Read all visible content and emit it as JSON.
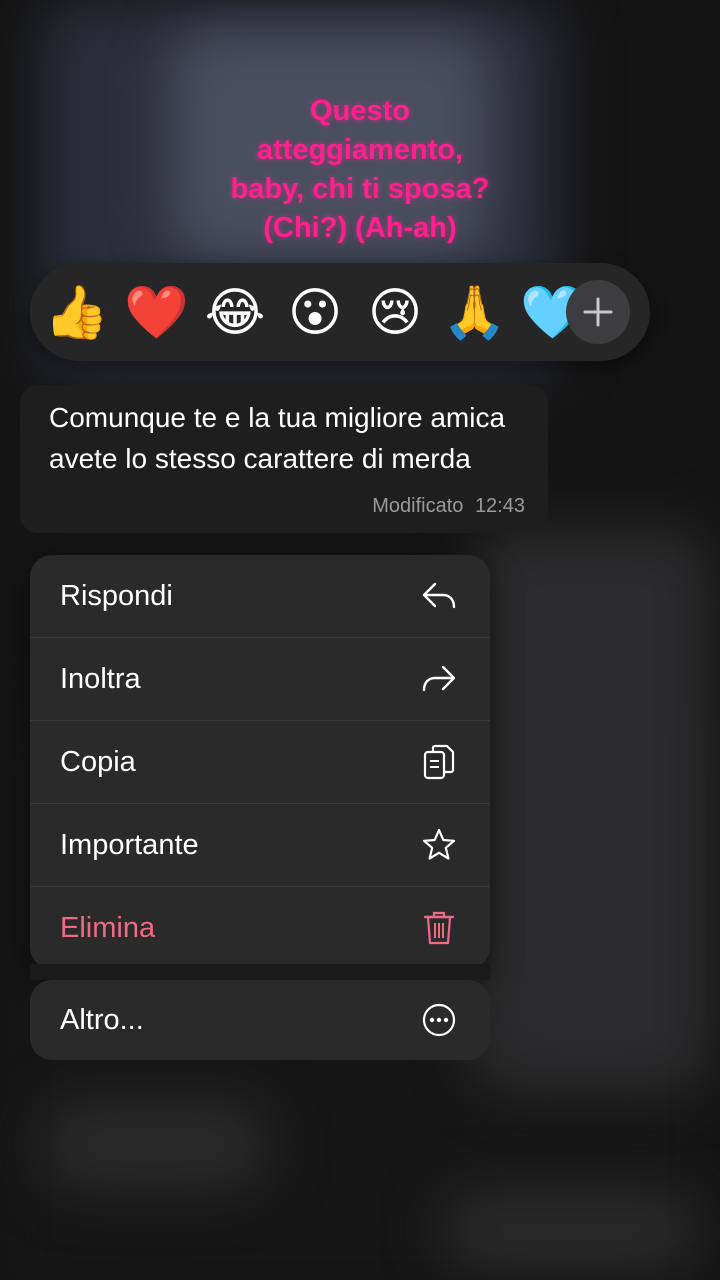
{
  "overlay": {
    "line1": "Questo",
    "line2": "atteggiamento,",
    "line3": "baby, chi ti sposa?",
    "line4": "(Chi?) (Ah-ah)",
    "color": "#ff1f8e"
  },
  "reactions": {
    "items": [
      "👍",
      "❤️",
      "😂",
      "😮",
      "😢",
      "🙏",
      "🩵"
    ],
    "more_icon": "plus-icon"
  },
  "message": {
    "text": "Comunque te e la tua migliore amica avete lo stesso carattere di merda",
    "edited_label": "Modificato",
    "time": "12:43"
  },
  "menu": {
    "items": [
      {
        "label": "Rispondi",
        "icon": "reply-icon"
      },
      {
        "label": "Inoltra",
        "icon": "forward-icon"
      },
      {
        "label": "Copia",
        "icon": "copy-icon"
      },
      {
        "label": "Importante",
        "icon": "star-icon"
      },
      {
        "label": "Elimina",
        "icon": "trash-icon",
        "color": "#f06a84"
      }
    ],
    "more": {
      "label": "Altro...",
      "icon": "ellipsis-circle-icon"
    }
  }
}
